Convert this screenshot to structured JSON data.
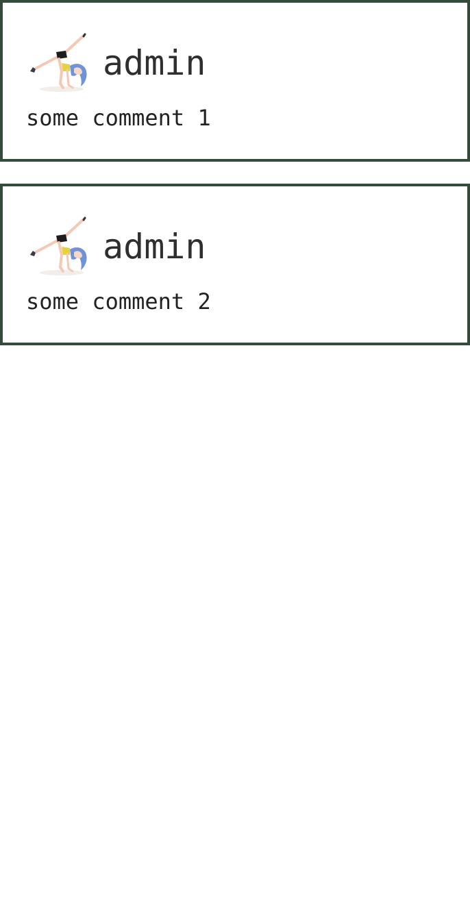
{
  "comments": [
    {
      "author": "admin",
      "text": "some comment 1",
      "avatar_icon": "gymnast-avatar-icon"
    },
    {
      "author": "admin",
      "text": "some comment 2",
      "avatar_icon": "gymnast-avatar-icon"
    }
  ],
  "colors": {
    "card_border": "#344a3a",
    "author_text": "#2f2f2f",
    "comment_text": "#222222",
    "background": "#ffffff"
  }
}
